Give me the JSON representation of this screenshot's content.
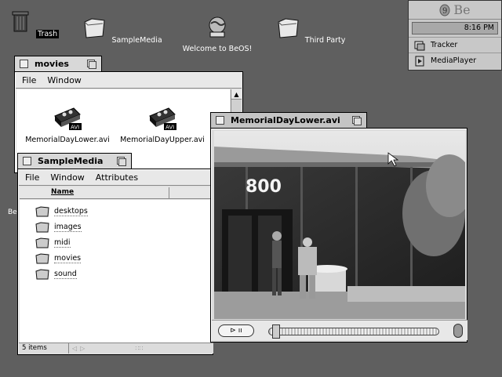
{
  "desktop": {
    "icons": [
      {
        "label": "Trash"
      },
      {
        "label": "SampleMedia"
      },
      {
        "label": "Welcome to BeOS!"
      },
      {
        "label": "Third Party"
      }
    ],
    "partial_label": "Be"
  },
  "deskbar": {
    "logo": "Be",
    "clock": "8:16 PM",
    "items": [
      {
        "label": "Tracker",
        "icon": "tracker-icon"
      },
      {
        "label": "MediaPlayer",
        "icon": "mediaplayer-icon"
      }
    ]
  },
  "movies_window": {
    "title": "movies",
    "menu": [
      "File",
      "Window"
    ],
    "files": [
      {
        "label": "MemorialDayLower.avi",
        "badge": "AVI"
      },
      {
        "label": "MemorialDayUpper.avi",
        "badge": "AVI"
      }
    ]
  },
  "samplemedia_window": {
    "title": "SampleMedia",
    "menu": [
      "File",
      "Window",
      "Attributes"
    ],
    "column_header": "Name",
    "rows": [
      "desktops",
      "images",
      "midi",
      "movies",
      "sound"
    ],
    "status": "5 items"
  },
  "player_window": {
    "title": "MemorialDayLower.avi",
    "video_overlay_text": "800",
    "play_label": "⊳ ıı",
    "position": 0.02
  },
  "colors": {
    "desktop": "#5f5f5f",
    "tab_active": "#c4c4c4",
    "window_bg": "#e2e2e2"
  }
}
